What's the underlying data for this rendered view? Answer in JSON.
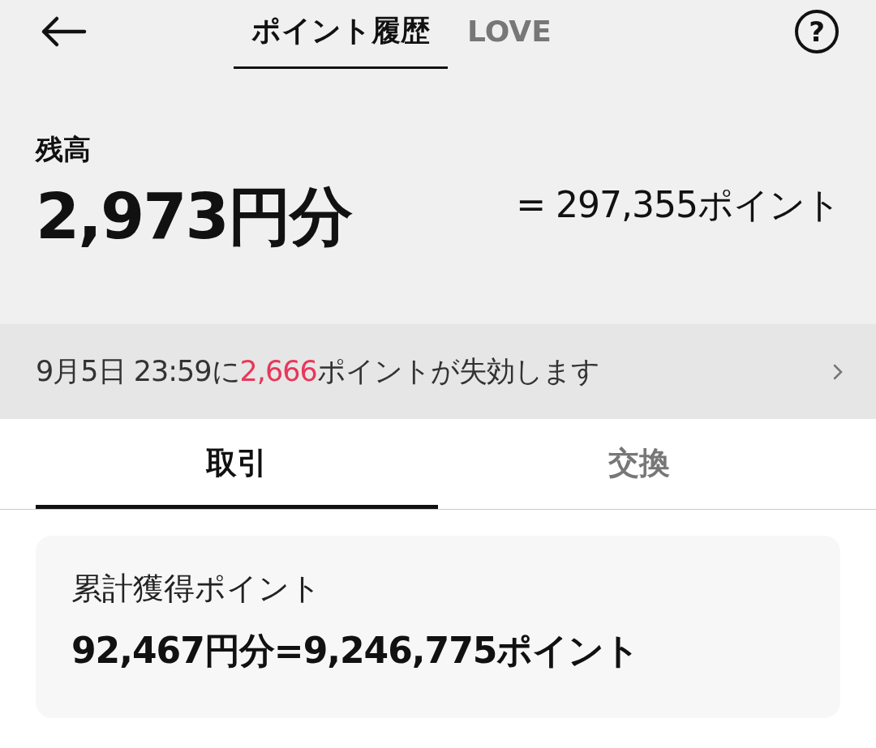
{
  "header": {
    "tabs": [
      {
        "label": "ポイント履歴",
        "selected": true
      },
      {
        "label": "LOVE",
        "selected": false
      }
    ],
    "help": "?"
  },
  "balance": {
    "label": "残高",
    "amount": "2,973円分",
    "points": "= 297,355ポイント"
  },
  "expiry": {
    "prefix": "9月5日 23:59に",
    "count": "2,666",
    "suffix": "ポイントが失効します",
    "color": "#e8375a"
  },
  "tabs": [
    {
      "label": "取引",
      "selected": true
    },
    {
      "label": "交換",
      "selected": false
    }
  ],
  "summary": {
    "title": "累計獲得ポイント",
    "value": "92,467円分=9,246,775ポイント"
  }
}
